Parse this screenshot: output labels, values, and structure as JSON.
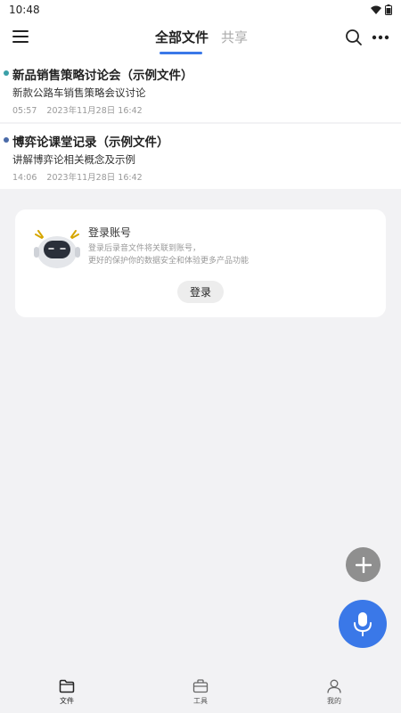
{
  "status_bar": {
    "time": "10:48"
  },
  "header": {
    "tabs": [
      {
        "label": "全部文件",
        "active": true
      },
      {
        "label": "共享",
        "active": false
      }
    ]
  },
  "files": [
    {
      "title": "新品销售策略讨论会（示例文件）",
      "description": "新款公路车销售策略会议讨论",
      "duration": "05:57",
      "date": "2023年11月28日 16:42",
      "dot_color": "#3aa0a8"
    },
    {
      "title": "博弈论课堂记录（示例文件）",
      "description": "讲解博弈论相关概念及示例",
      "duration": "14:06",
      "date": "2023年11月28日 16:42",
      "dot_color": "#4a6aa8"
    }
  ],
  "login_card": {
    "title": "登录账号",
    "desc_line1": "登录后录音文件将关联到账号，",
    "desc_line2": "更好的保护你的数据安全和体验更多产品功能",
    "button": "登录"
  },
  "bottom_nav": [
    {
      "label": "文件",
      "icon": "folder-icon",
      "active": true
    },
    {
      "label": "工具",
      "icon": "toolbox-icon",
      "active": false
    },
    {
      "label": "我的",
      "icon": "person-icon",
      "active": false
    }
  ],
  "colors": {
    "accent": "#3a78e8",
    "fab_gray": "#8f8f8f"
  }
}
